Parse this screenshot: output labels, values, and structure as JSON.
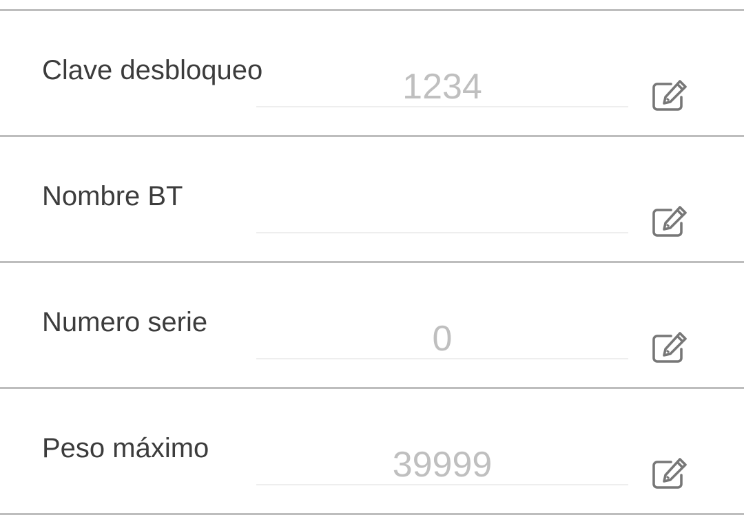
{
  "settings": {
    "rows": [
      {
        "label": "Clave desbloqueo",
        "value": "1234",
        "icon": "edit-icon"
      },
      {
        "label": "Nombre BT",
        "value": "",
        "icon": "edit-icon"
      },
      {
        "label": "Numero serie",
        "value": "0",
        "icon": "edit-icon"
      },
      {
        "label": "Peso máximo",
        "value": "39999",
        "icon": "edit-icon"
      }
    ]
  },
  "colors": {
    "label": "#3c3c3c",
    "value": "#bfbfbf",
    "divider": "#bdbdbd",
    "icon": "#777777"
  }
}
